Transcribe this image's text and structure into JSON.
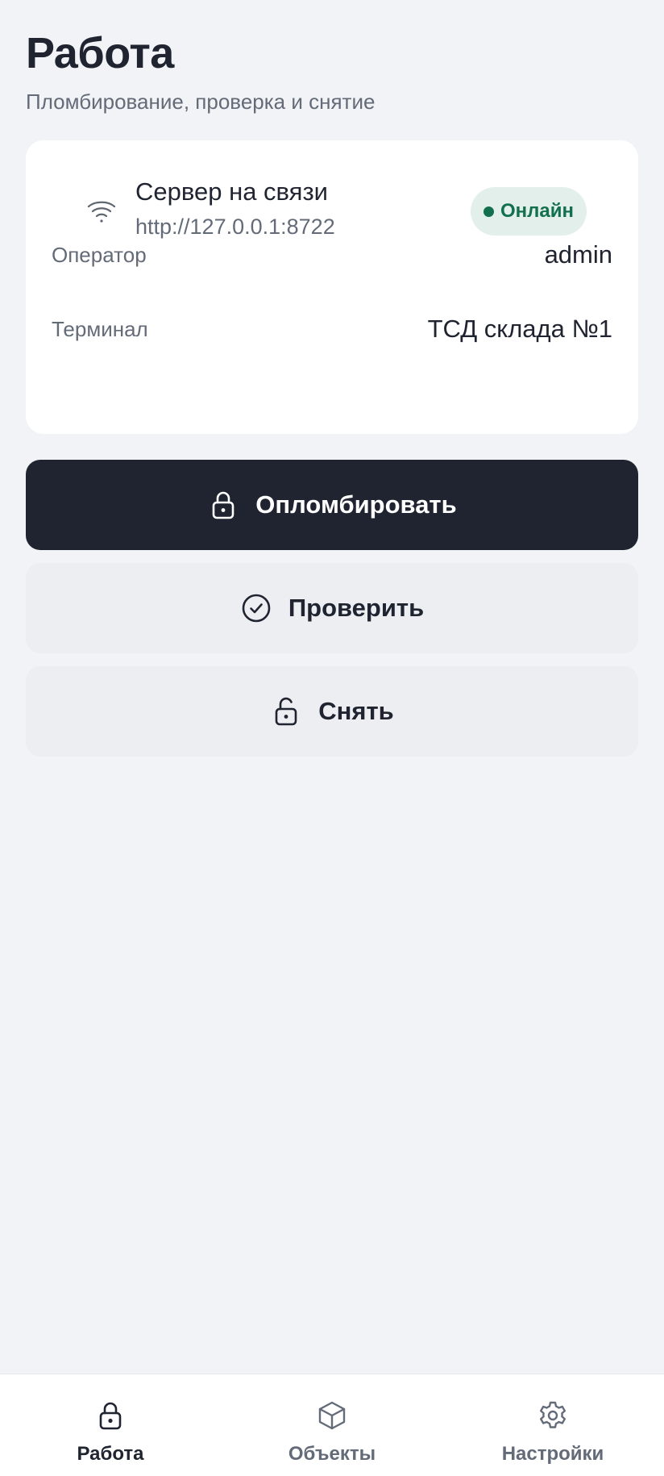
{
  "header": {
    "title": "Работа",
    "subtitle": "Пломбирование, проверка и снятие"
  },
  "server": {
    "icon": "wifi-icon",
    "title": "Сервер на связи",
    "url": "http://127.0.0.1:8722",
    "status_label": "Онлайн",
    "status_color": "#12704f"
  },
  "info": {
    "operator_label": "Оператор",
    "operator_value": "admin",
    "terminal_label": "Терминал",
    "terminal_value": "ТСД склада №1"
  },
  "actions": {
    "seal": {
      "label": "Опломбировать",
      "icon": "lock-icon"
    },
    "check": {
      "label": "Проверить",
      "icon": "check-circle-icon"
    },
    "remove": {
      "label": "Снять",
      "icon": "unlock-icon"
    }
  },
  "nav": {
    "items": [
      {
        "label": "Работа",
        "icon": "lock-icon",
        "active": true
      },
      {
        "label": "Объекты",
        "icon": "box-icon",
        "active": false
      },
      {
        "label": "Настройки",
        "icon": "gear-icon",
        "active": false
      }
    ]
  },
  "colors": {
    "background": "#f1f3f6",
    "primary": "#1f2430",
    "secondary_button": "#eceef2",
    "online_badge": "#e2efea"
  }
}
